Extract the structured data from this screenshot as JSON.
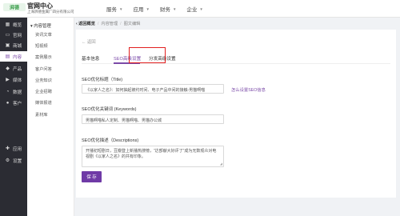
{
  "header": {
    "brand": "官网中心",
    "company": "上海湃德金属厂四分有限公司",
    "nav": [
      {
        "label": "服务"
      },
      {
        "label": "应用"
      },
      {
        "label": "财务"
      },
      {
        "label": "企业"
      }
    ]
  },
  "sidebar": {
    "items": [
      {
        "label": "概览",
        "icon": "grid-icon"
      },
      {
        "label": "官网",
        "icon": "monitor-icon"
      },
      {
        "label": "商城",
        "icon": "cart-icon"
      },
      {
        "label": "内容",
        "icon": "document-icon"
      },
      {
        "label": "产品",
        "icon": "cube-icon"
      },
      {
        "label": "媒体",
        "icon": "media-icon"
      },
      {
        "label": "数据",
        "icon": "chart-icon"
      },
      {
        "label": "客户",
        "icon": "user-icon"
      }
    ],
    "bottom_items": [
      {
        "label": "应用",
        "icon": "apps-icon"
      },
      {
        "label": "设置",
        "icon": "gear-icon"
      }
    ]
  },
  "submenu": {
    "title": "内容管理",
    "items": [
      {
        "label": "资讯文章"
      },
      {
        "label": "短视频"
      },
      {
        "label": "案例展示"
      },
      {
        "label": "客户问答"
      },
      {
        "label": "业务知识"
      },
      {
        "label": "企业招聘"
      },
      {
        "label": "媒体报道"
      },
      {
        "label": "素材库"
      }
    ]
  },
  "breadcrumb": {
    "back": "返回概览",
    "items": [
      "内容管理",
      "图文编辑"
    ]
  },
  "page": {
    "back_link": "返回",
    "tabs": [
      {
        "label": "基本信息"
      },
      {
        "label": "SEO高级设置"
      },
      {
        "label": "分发高级设置"
      }
    ],
    "seo_title_label": "SEO优化标题（Title)",
    "seo_title_value": "《以家人之名》：如何抽起被约时间、电子产品中间的接触-男猫啊喵",
    "seo_link": "怎么设置SEO信息",
    "seo_keywords_label": "SEO优化关键词 (Keywords)",
    "seo_keywords_value": "男猫啊喵私人定制、男猫啊喵、男猫办公城",
    "seo_desc_label": "SEO优化描述（Descriptions)",
    "seo_desc_value": "开播初短剧日，豆瓣登上新播热搜榜，“达部献大好评了”成为无数观众对电视剧《以家人之名》的共有印象。",
    "save_label": "保 存"
  },
  "colors": {
    "accent": "#7b4aa8",
    "sidebar_bg": "#2b2c33",
    "highlight": "#e21f1f"
  }
}
